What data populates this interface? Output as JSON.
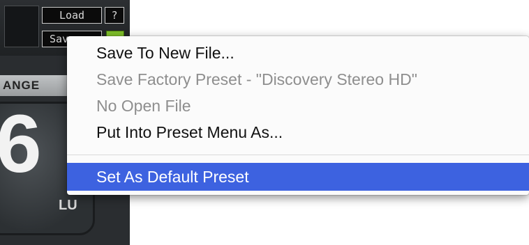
{
  "plugin": {
    "load_label": "Load",
    "help_label": "?",
    "save_label": "Save",
    "range_label": "ANGE",
    "display_value": "6",
    "unit": "LU"
  },
  "menu": {
    "items": [
      {
        "label": "Save To New File...",
        "state": "enabled"
      },
      {
        "label": "Save Factory Preset - \"Discovery Stereo HD\"",
        "state": "disabled"
      },
      {
        "label": "No Open File",
        "state": "disabled"
      },
      {
        "label": "Put Into Preset Menu As...",
        "state": "enabled"
      },
      {
        "label": "Set As Default Preset",
        "state": "selected"
      }
    ],
    "highlight_color": "#3d62e0"
  }
}
